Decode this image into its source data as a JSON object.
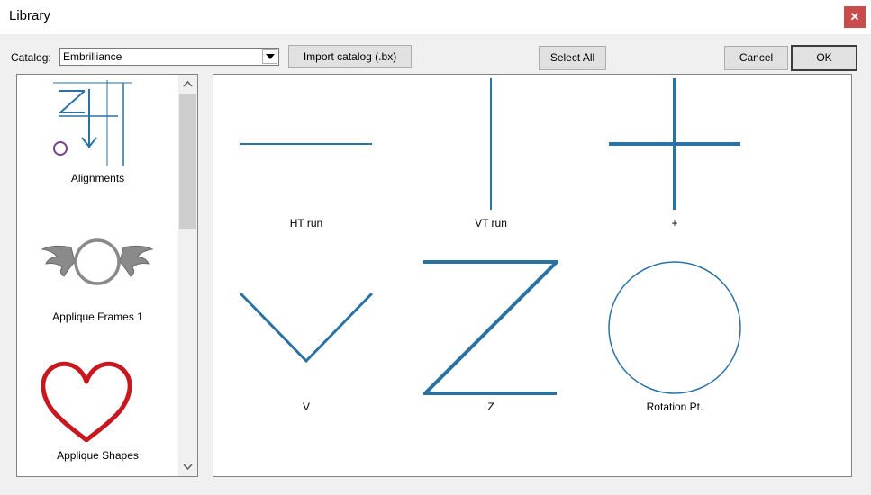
{
  "window": {
    "title": "Library"
  },
  "toolbar": {
    "catalog_label": "Catalog:",
    "catalog_value": "Embrilliance",
    "import_label": "Import catalog (.bx)",
    "select_all_label": "Select All",
    "cancel_label": "Cancel",
    "ok_label": "OK"
  },
  "catalogs": [
    {
      "label": "Alignments",
      "icon": "alignments-thumbnail"
    },
    {
      "label": "Applique Frames 1",
      "icon": "winged-frame-thumbnail"
    },
    {
      "label": "Applique Shapes",
      "icon": "heart-thumbnail"
    }
  ],
  "designs": [
    {
      "label": "HT run",
      "icon": "horizontal-run-design"
    },
    {
      "label": "VT run",
      "icon": "vertical-run-design"
    },
    {
      "label": "+",
      "icon": "plus-design"
    },
    {
      "label": "V",
      "icon": "v-design"
    },
    {
      "label": "Z",
      "icon": "z-design"
    },
    {
      "label": "Rotation Pt.",
      "icon": "circle-design"
    }
  ],
  "colors": {
    "stitch_blue": "#2b72a4",
    "heart_red": "#c8171e",
    "close_red": "#c94b4b"
  }
}
